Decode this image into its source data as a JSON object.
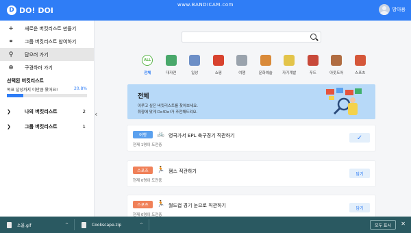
{
  "app": {
    "logo_text": "DO! DOI",
    "logo_mark": "D",
    "watermark": "www.BANDICAM.com",
    "user_name": "망아용"
  },
  "sidebar": {
    "menu": [
      {
        "icon": "plus-icon",
        "glyph": "+",
        "label": "새로운 버킷리스트 만들기"
      },
      {
        "icon": "group-icon",
        "glyph": "⚭",
        "label": "그룹 버킷리스트 참여하기"
      },
      {
        "icon": "search-icon",
        "glyph": "⚲",
        "label": "담으러 가기"
      },
      {
        "icon": "globe-icon",
        "glyph": "⊕",
        "label": "구경하러 가기"
      }
    ],
    "selected_title": "선택된 버킷리스트",
    "goal_text": "목표 달성까지 이만큼 왔어요!",
    "goal_percent_label": "20.8%",
    "goal_progress": 0.208,
    "groups": [
      {
        "label": "나의 버킷리스트",
        "count": "2"
      },
      {
        "label": "그룹 버킷리스트",
        "count": "1"
      }
    ],
    "collapse_glyph": "‹"
  },
  "search": {
    "placeholder": ""
  },
  "categories": [
    {
      "label": "전체",
      "active": true,
      "color": "#5bb54a"
    },
    {
      "label": "대자연",
      "active": false,
      "color": "#49a86b"
    },
    {
      "label": "일상",
      "active": false,
      "color": "#6d8fc7"
    },
    {
      "label": "쇼핑",
      "active": false,
      "color": "#d8432f"
    },
    {
      "label": "여행",
      "active": false,
      "color": "#9aa3ad"
    },
    {
      "label": "문화예술",
      "active": false,
      "color": "#d98a3a"
    },
    {
      "label": "자기계발",
      "active": false,
      "color": "#e3c44a"
    },
    {
      "label": "푸드",
      "active": false,
      "color": "#c8493a"
    },
    {
      "label": "아웃도어",
      "active": false,
      "color": "#b06d42"
    },
    {
      "label": "스포츠",
      "active": false,
      "color": "#d5573a"
    }
  ],
  "banner": {
    "title": "전체",
    "line1": "이루고 싶은 버킷리스트를 찾아보세요.",
    "line2": "취향에 맞게 Do!Do!가 추천해드려요."
  },
  "items": [
    {
      "tag": "여행",
      "tag_color": "#5aa0ee",
      "icon": "bicycle-icon",
      "glyph": "🚲",
      "title": "영국가서 EPL 축구경기 직관하기",
      "sub": "현재 1명이 도전중",
      "action": "✓",
      "checked": true
    },
    {
      "tag": "스포츠",
      "tag_color": "#f08058",
      "icon": "runner-icon",
      "glyph": "🏃",
      "title": "잼스 직관하기",
      "sub": "현재 0명이 도전중",
      "action": "담기",
      "checked": false
    },
    {
      "tag": "스포츠",
      "tag_color": "#f08058",
      "icon": "runner-icon",
      "glyph": "🏃",
      "title": "월드컵 경기 눈으로 직관하기",
      "sub": "현재 0명이 도전중",
      "action": "담기",
      "checked": false
    }
  ],
  "downloads": {
    "files": [
      {
        "name": "소울.gif",
        "arrow": "^"
      },
      {
        "name": "Cookscape.zip",
        "arrow": "^"
      }
    ],
    "show_all": "모두 표시",
    "close": "✕"
  },
  "colors": {
    "accent": "#2f7df6",
    "banner_bg": "#b7d9f8",
    "download_bar": "#2a5961"
  }
}
